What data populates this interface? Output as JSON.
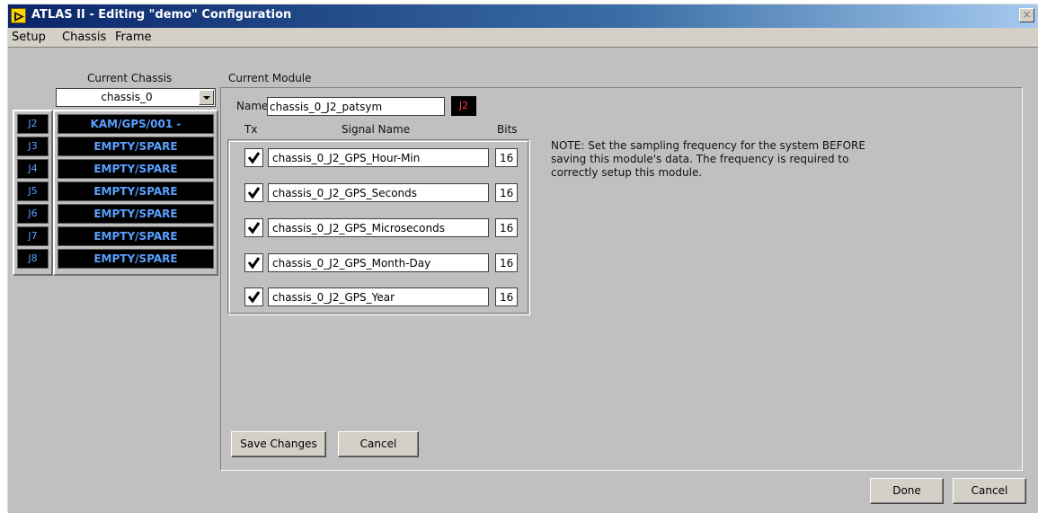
{
  "window": {
    "title": "ATLAS II - Editing \"demo\" Configuration",
    "close_glyph": "×"
  },
  "menu": [
    "Setup",
    "Chassis",
    "Frame"
  ],
  "chassis": {
    "label": "Current Chassis",
    "selected": "chassis_0",
    "slots": [
      {
        "id": "J2",
        "name": "KAM/GPS/001 -"
      },
      {
        "id": "J3",
        "name": "EMPTY/SPARE"
      },
      {
        "id": "J4",
        "name": "EMPTY/SPARE"
      },
      {
        "id": "J5",
        "name": "EMPTY/SPARE"
      },
      {
        "id": "J6",
        "name": "EMPTY/SPARE"
      },
      {
        "id": "J7",
        "name": "EMPTY/SPARE"
      },
      {
        "id": "J8",
        "name": "EMPTY/SPARE"
      }
    ]
  },
  "module": {
    "label": "Current Module",
    "name_label": "Name",
    "name_value": "chassis_0_J2_patsym",
    "slot_badge": "J2",
    "columns": {
      "tx": "Tx",
      "signal": "Signal Name",
      "bits": "Bits"
    },
    "signals": [
      {
        "tx": true,
        "name": "chassis_0_J2_GPS_Hour-Min",
        "bits": "16"
      },
      {
        "tx": true,
        "name": "chassis_0_J2_GPS_Seconds",
        "bits": "16"
      },
      {
        "tx": true,
        "name": "chassis_0_J2_GPS_Microseconds",
        "bits": "16"
      },
      {
        "tx": true,
        "name": "chassis_0_J2_GPS_Month-Day",
        "bits": "16"
      },
      {
        "tx": true,
        "name": "chassis_0_J2_GPS_Year",
        "bits": "16"
      }
    ],
    "note_lines": [
      "NOTE:  Set the sampling frequency for the system BEFORE",
      "saving this module's data.  The frequency is required to",
      "correctly setup this module."
    ],
    "save_label": "Save Changes",
    "cancel_label": "Cancel"
  },
  "footer": {
    "done_label": "Done",
    "cancel_label": "Cancel"
  },
  "colors": {
    "slot_text": "#5aa0ff",
    "badge_text": "#ff3b3b",
    "panel_bg": "#c0c0c0"
  }
}
